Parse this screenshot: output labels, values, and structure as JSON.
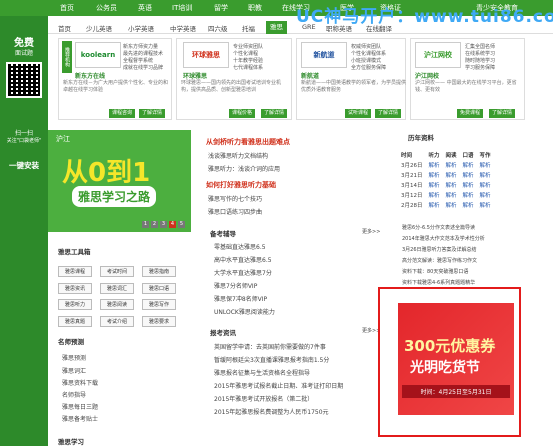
{
  "topnav": {
    "items": [
      "首页",
      "公务员",
      "英语",
      "IT培训",
      "留学",
      "职教",
      "在线学习",
      "医学",
      "资格证",
      "青少安全教育"
    ]
  },
  "watermark": "UC神马开户：www.tui86.com",
  "subnav": {
    "items": [
      "首页",
      "少儿英语",
      "小学英语",
      "中学英语",
      "四六级",
      "托福",
      "雅思",
      "GRE",
      "职称英语",
      "在线翻译"
    ],
    "active_index": 6
  },
  "sidebar": {
    "free_label": "免费",
    "free_sub": "面试题",
    "scan_label": "扫一扫",
    "scan_sub": "关注\"口袋老师\"",
    "install_label": "一键安装"
  },
  "partners": [
    {
      "logo": "koolearn",
      "name": "新东方在线",
      "bullets": [
        "新东方师资力量",
        "最先进的课程技术",
        "全程督学系统",
        "成就在线学习品牌"
      ],
      "desc": "新东方在线－为广大用户提供个性化、专业的和卓越在线学习体验",
      "btn1": "课程咨询",
      "btn2": "了解详情"
    },
    {
      "logo": "环球雅思",
      "name": "环球雅思",
      "bullets": [
        "专业师资团队",
        "个性化课程",
        "十年教学经验",
        "七代课程体系"
      ],
      "desc": "环球雅思——国内领先的出国考试培训专业机构，提供高品质、创新型雅思培训",
      "btn1": "课程价格",
      "btn2": "了解详情"
    },
    {
      "logo": "新航道",
      "name": "新航道",
      "bullets": [
        "权威师资团队",
        "个性化课程体系",
        "小班授课模式",
        "全方位服务保障"
      ],
      "desc": "新航道——中国英语教学的领军者，为学员提供优质外语教育服务",
      "btn1": "试听课程",
      "btn2": "了解详情"
    },
    {
      "logo": "沪江网校",
      "name": "沪江网校",
      "bullets": [
        "汇集全国名师",
        "在线系统学习",
        "随时随地学习",
        "学习服务保障"
      ],
      "desc": "沪江网校—— 中国最大的在线学习平台，更省钱、更有效",
      "btn1": "免费课程",
      "btn2": "了解详情"
    }
  ],
  "banner": {
    "brand": "沪江",
    "headline": "从0到1",
    "subline": "雅思学习之路",
    "pages": [
      "1",
      "2",
      "3",
      "4",
      "5"
    ]
  },
  "news_top": {
    "red1": "从剑桥听力看雅思出题难点",
    "links1": [
      "浅谈雅思听力文档结构",
      "雅思听力：浅谈介词的应用"
    ],
    "red2": "如何打好雅思听力基础",
    "links2": [
      "雅思写作的七个技巧",
      "雅思口语练习四步曲"
    ]
  },
  "tools": {
    "title": "雅思工具箱",
    "buttons": [
      "雅思课程",
      "考试时间",
      "雅思指南",
      "雅思资讯",
      "雅思词汇",
      "雅思口语",
      "雅思听力",
      "雅思阅读",
      "雅思写作",
      "雅思真题",
      "考试介绍",
      "雅思要求"
    ]
  },
  "ranking": {
    "title": "名师预测",
    "items": [
      "雅思预测",
      "雅思词汇",
      "雅思资料下载",
      "名师指导",
      "雅思每日三题",
      "雅思备考贴士"
    ]
  },
  "guide": {
    "title": "备考辅导",
    "more": "更多>>",
    "items": [
      "零基础直达雅思6.5",
      "高中水平直达雅思6.5",
      "大学水平直达雅思7分",
      "雅思7分名师VIP",
      "雅思保7冲8名师VIP",
      "UNLOCK雅思阅读能力"
    ]
  },
  "news": {
    "title": "报考资讯",
    "more": "更多>>",
    "items": [
      "英国留学申请：去英国前你需要做的7件事",
      "暂缓阿根廷尖3次直播课雅思报考指南1.5分",
      "雅思报名征集与生活资格名全程指导",
      "2015年雅思考试报名截止日期、准考证打印日期",
      "2015年雅思考试开放报名（第二批）",
      "2015年起雅思报名费调整为人民币1750元"
    ]
  },
  "history": {
    "title": "历年资料",
    "headers": [
      "时间",
      "听力",
      "阅读",
      "口语",
      "写作"
    ],
    "rows": [
      [
        "3月26日",
        "解析",
        "解析",
        "解析",
        "解析"
      ],
      [
        "3月21日",
        "解析",
        "解析",
        "解析",
        "解析"
      ],
      [
        "3月14日",
        "解析",
        "解析",
        "解析",
        "解析"
      ],
      [
        "3月12日",
        "解析",
        "解析",
        "解析",
        "解析"
      ],
      [
        "2月28日",
        "解析",
        "解析",
        "解析",
        "解析"
      ]
    ],
    "links": [
      "雅思6分-6.5分作文表述全篇导读",
      "2014年雅思大作文范本及学术性分析",
      "3月26日雅思听力答案及详解总结",
      "高分范文解读：雅思写作练习作文",
      "资料下载：80天突破雅思口语",
      "资料下载雅思4-6系列真题题精华",
      "雅思高频英式考点精解"
    ]
  },
  "ad": {
    "headline": "300元优惠券",
    "subline": "光明吃货节",
    "date": "时间：4月25日至5月31日"
  },
  "footer": {
    "title": "雅思学习"
  }
}
